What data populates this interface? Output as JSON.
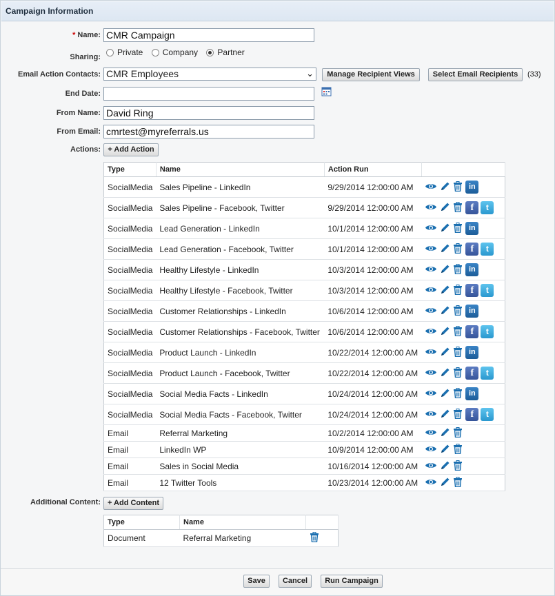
{
  "header": {
    "title": "Campaign Information"
  },
  "form": {
    "name_label": "Name:",
    "name_value": "CMR Campaign",
    "sharing_label": "Sharing:",
    "sharing_options": [
      "Private",
      "Company",
      "Partner"
    ],
    "sharing_selected": "Partner",
    "contacts_label": "Email Action Contacts:",
    "contacts_value": "CMR Employees",
    "manage_views_label": "Manage Recipient Views",
    "select_recipients_label": "Select Email Recipients",
    "recipient_count": "(33)",
    "end_date_label": "End Date:",
    "end_date_value": "",
    "from_name_label": "From Name:",
    "from_name_value": "David Ring",
    "from_email_label": "From Email:",
    "from_email_value": "cmrtest@myreferrals.us",
    "actions_label": "Actions:",
    "add_action_label": "+ Add Action",
    "additional_label": "Additional Content:",
    "add_content_label": "+ Add Content"
  },
  "actions_table": {
    "columns": [
      "Type",
      "Name",
      "Action Run"
    ],
    "rows": [
      {
        "type": "SocialMedia",
        "name": "Sales Pipeline - LinkedIn",
        "run": "9/29/2014 12:00:00 AM",
        "social": [
          "linkedin"
        ]
      },
      {
        "type": "SocialMedia",
        "name": "Sales Pipeline - Facebook, Twitter",
        "run": "9/29/2014 12:00:00 AM",
        "social": [
          "facebook",
          "twitter"
        ]
      },
      {
        "type": "SocialMedia",
        "name": "Lead Generation - LinkedIn",
        "run": "10/1/2014 12:00:00 AM",
        "social": [
          "linkedin"
        ]
      },
      {
        "type": "SocialMedia",
        "name": "Lead Generation - Facebook, Twitter",
        "run": "10/1/2014 12:00:00 AM",
        "social": [
          "facebook",
          "twitter"
        ]
      },
      {
        "type": "SocialMedia",
        "name": "Healthy Lifestyle - LinkedIn",
        "run": "10/3/2014 12:00:00 AM",
        "social": [
          "linkedin"
        ]
      },
      {
        "type": "SocialMedia",
        "name": "Healthy Lifestyle - Facebook, Twitter",
        "run": "10/3/2014 12:00:00 AM",
        "social": [
          "facebook",
          "twitter"
        ]
      },
      {
        "type": "SocialMedia",
        "name": "Customer Relationships - LinkedIn",
        "run": "10/6/2014 12:00:00 AM",
        "social": [
          "linkedin"
        ]
      },
      {
        "type": "SocialMedia",
        "name": "Customer Relationships - Facebook, Twitter",
        "run": "10/6/2014 12:00:00 AM",
        "social": [
          "facebook",
          "twitter"
        ]
      },
      {
        "type": "SocialMedia",
        "name": "Product Launch - LinkedIn",
        "run": "10/22/2014 12:00:00 AM",
        "social": [
          "linkedin"
        ]
      },
      {
        "type": "SocialMedia",
        "name": "Product Launch - Facebook, Twitter",
        "run": "10/22/2014 12:00:00 AM",
        "social": [
          "facebook",
          "twitter"
        ]
      },
      {
        "type": "SocialMedia",
        "name": "Social Media Facts - LinkedIn",
        "run": "10/24/2014 12:00:00 AM",
        "social": [
          "linkedin"
        ]
      },
      {
        "type": "SocialMedia",
        "name": "Social Media Facts - Facebook, Twitter",
        "run": "10/24/2014 12:00:00 AM",
        "social": [
          "facebook",
          "twitter"
        ]
      },
      {
        "type": "Email",
        "name": "Referral Marketing",
        "run": "10/2/2014 12:00:00 AM",
        "social": []
      },
      {
        "type": "Email",
        "name": "LinkedIn WP",
        "run": "10/9/2014 12:00:00 AM",
        "social": []
      },
      {
        "type": "Email",
        "name": "Sales in Social Media",
        "run": "10/16/2014 12:00:00 AM",
        "social": []
      },
      {
        "type": "Email",
        "name": "12 Twitter Tools",
        "run": "10/23/2014 12:00:00 AM",
        "social": []
      }
    ]
  },
  "content_table": {
    "columns": [
      "Type",
      "Name"
    ],
    "rows": [
      {
        "type": "Document",
        "name": "Referral Marketing"
      }
    ]
  },
  "icons": {
    "view": "eye-icon",
    "edit": "pencil-icon",
    "delete": "trash-icon",
    "linkedin": "linkedin-icon",
    "facebook": "facebook-icon",
    "twitter": "twitter-icon",
    "calendar": "calendar-icon"
  },
  "social_glyphs": {
    "linkedin": "in",
    "facebook": "f",
    "twitter": "t"
  },
  "colors": {
    "accent": "#1a6fb0",
    "header_bg": "#e4ecf5",
    "required": "#cc0000"
  },
  "footer": {
    "save_label": "Save",
    "cancel_label": "Cancel",
    "run_label": "Run Campaign"
  }
}
